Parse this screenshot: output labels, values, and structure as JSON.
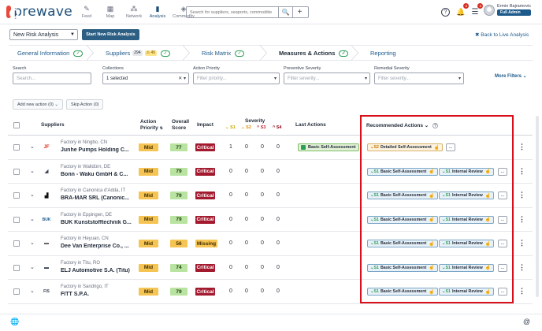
{
  "app": {
    "logo_text": "prewave"
  },
  "nav": [
    {
      "label": "Feed",
      "icon": "feed-icon",
      "glyph": "✎"
    },
    {
      "label": "Map",
      "icon": "map-icon",
      "glyph": "▦"
    },
    {
      "label": "Network",
      "icon": "network-icon",
      "glyph": "⁂"
    },
    {
      "label": "Analysis",
      "icon": "analysis-icon",
      "glyph": "▮"
    },
    {
      "label": "Commodity",
      "icon": "commodity-icon",
      "glyph": "◈"
    }
  ],
  "search": {
    "placeholder": "Search for suppliers, seaports, commoditie",
    "search_glyph": "🔍",
    "add_glyph": "+"
  },
  "topright": {
    "help_glyph": "?",
    "bell_glyph": "🔔",
    "bell_badge": "4",
    "tasks_glyph": "☰",
    "tasks_badge": "4"
  },
  "user": {
    "name": "Ermin Bajramovic",
    "role": "Full Admin"
  },
  "controls": {
    "analysis_select": "New Risk Analysis",
    "new_analysis_button": "Start New Risk Analysis",
    "back_link": "✖ Back to Live Analysis"
  },
  "steps": [
    {
      "label": "General Information",
      "check": "✓"
    },
    {
      "label": "Suppliers",
      "count": "294",
      "warn": "⚠ 45",
      "check": "✓"
    },
    {
      "label": "Risk Matrix",
      "check": "✓"
    },
    {
      "label": "Measures & Actions",
      "check": "✓"
    },
    {
      "label": "Reporting"
    }
  ],
  "filters": {
    "search": {
      "label": "Search",
      "placeholder": "Search..."
    },
    "collections": {
      "label": "Collections",
      "value": "1 selected"
    },
    "action_priority": {
      "label": "Action Priority",
      "placeholder": "Filter priority..."
    },
    "preventive_severity": {
      "label": "Preventive Severity",
      "placeholder": "Filter severity..."
    },
    "remedial_severity": {
      "label": "Remedial Severity",
      "placeholder": "Filter severity..."
    },
    "more": "More Filters ⌄"
  },
  "actions": {
    "add_new": "Add new action (0) ⌄",
    "skip": "Skip Action (0)"
  },
  "table": {
    "headers": {
      "suppliers": "Suppliers",
      "action_priority": "Action Priority",
      "overall_score": "Overall Score",
      "impact": "Impact",
      "severity": "Severity",
      "sev_s1": "S1",
      "sev_s2": "S2",
      "sev_s3": "S3",
      "sev_s4": "S4",
      "last_actions": "Last Actions",
      "recommended": "Recommended Actions ⌄"
    },
    "rows": [
      {
        "location": "Factory in Ningbo, CN",
        "name": "Junhe Pumps Holding C...",
        "logo": "JF",
        "priority": "Mid",
        "score": "77",
        "impact": "Critical",
        "sev": [
          "1",
          "0",
          "0",
          "0"
        ],
        "last_action": "Basic Self-Assessment",
        "recommended": [
          {
            "level": "S2",
            "label": "Detailed Self-Assessment"
          }
        ]
      },
      {
        "location": "Factory in Walldürn, DE",
        "name": "Bonn - Waku GmbH & C...",
        "logo": "◢",
        "priority": "Mid",
        "score": "79",
        "impact": "Critical",
        "sev": [
          "0",
          "0",
          "0",
          "0"
        ],
        "last_action": "",
        "recommended": [
          {
            "level": "S1",
            "label": "Basic Self-Assessment"
          },
          {
            "level": "S1",
            "label": "Internal Review"
          }
        ]
      },
      {
        "location": "Factory in Canonica d'Adda, IT",
        "name": "BRA-MAR SRL (Canonic...",
        "logo": "▟",
        "priority": "Mid",
        "score": "79",
        "impact": "Critical",
        "sev": [
          "0",
          "0",
          "0",
          "0"
        ],
        "last_action": "",
        "recommended": [
          {
            "level": "S1",
            "label": "Basic Self-Assessment"
          },
          {
            "level": "S1",
            "label": "Internal Review"
          }
        ]
      },
      {
        "location": "Factory in Eppingen, DE",
        "name": "BUK Kunststofftechnik G...",
        "logo": "BUK",
        "priority": "Mid",
        "score": "79",
        "impact": "Critical",
        "sev": [
          "0",
          "0",
          "0",
          "0"
        ],
        "last_action": "",
        "recommended": [
          {
            "level": "S1",
            "label": "Basic Self-Assessment"
          },
          {
            "level": "S1",
            "label": "Internal Review"
          }
        ]
      },
      {
        "location": "Factory in Heyuan, CN",
        "name": "Dee Van Enterprise Co., ...",
        "logo": "▬",
        "priority": "Mid",
        "score": "56",
        "impact": "Missing",
        "sev": [
          "0",
          "0",
          "0",
          "0"
        ],
        "last_action": "",
        "recommended": [
          {
            "level": "S1",
            "label": "Basic Self-Assessment"
          },
          {
            "level": "S1",
            "label": "Internal Review"
          }
        ]
      },
      {
        "location": "Factory in Titu, RO",
        "name": "ELJ Automotive S.A. (Titu)",
        "logo": "▬",
        "priority": "Mid",
        "score": "74",
        "impact": "Critical",
        "sev": [
          "0",
          "0",
          "0",
          "0"
        ],
        "last_action": "",
        "recommended": [
          {
            "level": "S1",
            "label": "Basic Self-Assessment"
          },
          {
            "level": "S1",
            "label": "Internal Review"
          }
        ]
      },
      {
        "location": "Factory in Sandrigo, IT",
        "name": "FITT S.P.A.",
        "logo": "FIS",
        "priority": "Mid",
        "score": "79",
        "impact": "Critical",
        "sev": [
          "0",
          "0",
          "0",
          "0"
        ],
        "last_action": "",
        "recommended": [
          {
            "level": "S1",
            "label": "Basic Self-Assessment"
          },
          {
            "level": "S1",
            "label": "Internal Review"
          }
        ]
      }
    ]
  },
  "more_glyph": "...",
  "kebab_glyph": "⋮",
  "hand_glyph": "☝",
  "colors": {
    "accent": "#1d5a8c",
    "critical": "#a3192e",
    "highlight": "#d90f1a",
    "mid": "#f6c453",
    "score_ok": "#b9e3a0"
  }
}
